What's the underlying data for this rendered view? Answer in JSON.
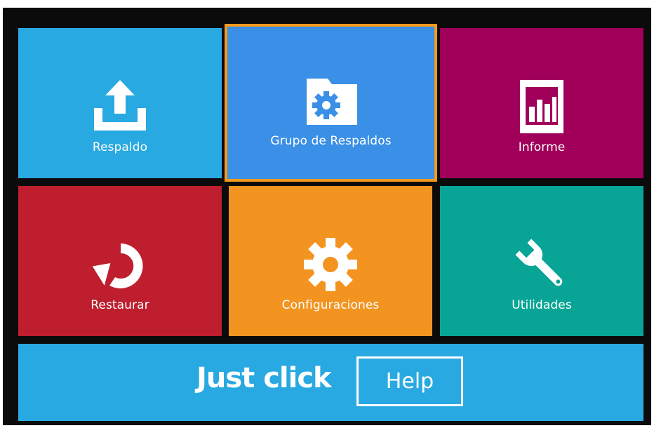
{
  "tiles": {
    "backup": {
      "label": "Respaldo",
      "icon": "upload-tray-icon",
      "color": "#29a9e1"
    },
    "group": {
      "label": "Grupo de Respaldos",
      "icon": "folder-gear-icon",
      "color": "#3a8fe6",
      "selected": true,
      "highlight_color": "#f39a1e"
    },
    "report": {
      "label": "Informe",
      "icon": "bar-chart-icon",
      "color": "#a0005a"
    },
    "restore": {
      "label": "Restaurar",
      "icon": "restore-arrow-icon",
      "color": "#be1e2d"
    },
    "settings": {
      "label": "Configuraciones",
      "icon": "gear-icon",
      "color": "#f39420"
    },
    "utilities": {
      "label": "Utilidades",
      "icon": "wrench-icon",
      "color": "#08a596"
    }
  },
  "banner": {
    "slogan": "Just click",
    "help_label": "Help",
    "color": "#29a9e1"
  }
}
